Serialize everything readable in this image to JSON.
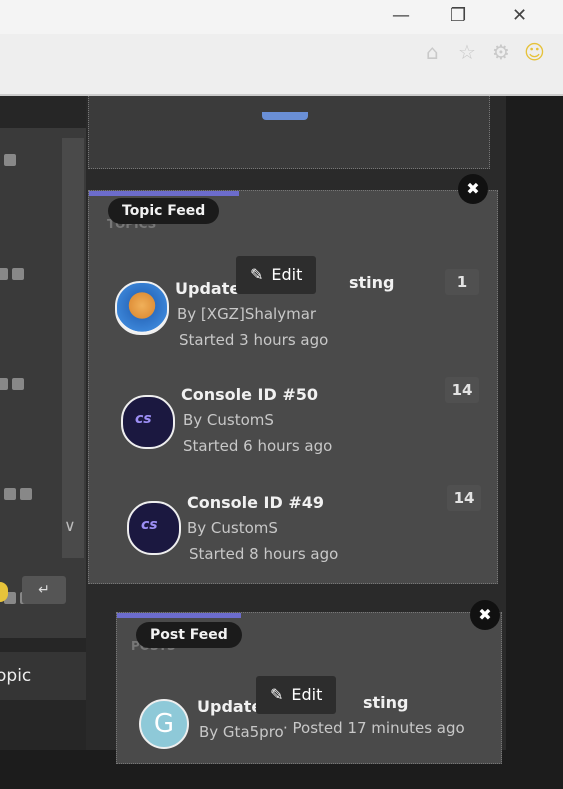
{
  "window": {
    "minimize": "—",
    "restore": "❐",
    "close": "✕"
  },
  "toolbar": {
    "icons": [
      "home-icon",
      "star-icon",
      "gear-icon",
      "smiley-icon"
    ]
  },
  "left": {
    "topic_label": "opic",
    "enter_glyph": "↵",
    "chevron": "∨"
  },
  "topic_feed": {
    "label": "Topic Feed",
    "ghost": "TOPICS",
    "close": "✖",
    "edit_label": "Edit",
    "topics": [
      {
        "title": "Update",
        "title_tail": "sting",
        "author": "By [XGZ]Shalymar",
        "started": "Started 3 hours ago",
        "count": "1",
        "avatar": "colorful"
      },
      {
        "title": "Console ID #50",
        "author": "By CustomS",
        "started": "Started 6 hours ago",
        "count": "14",
        "avatar": "dark"
      },
      {
        "title": "Console ID #49",
        "author": "By CustomS",
        "started": "Started 8 hours ago",
        "count": "14",
        "avatar": "dark"
      }
    ]
  },
  "post_feed": {
    "label": "Post Feed",
    "ghost": "POSTS",
    "close": "✖",
    "edit_label": "Edit",
    "posts": [
      {
        "title": "Update",
        "title_tail": "sting",
        "author": "By Gta5pro",
        "posted": " · Posted 17 minutes ago",
        "avatar_letter": "G"
      }
    ]
  }
}
